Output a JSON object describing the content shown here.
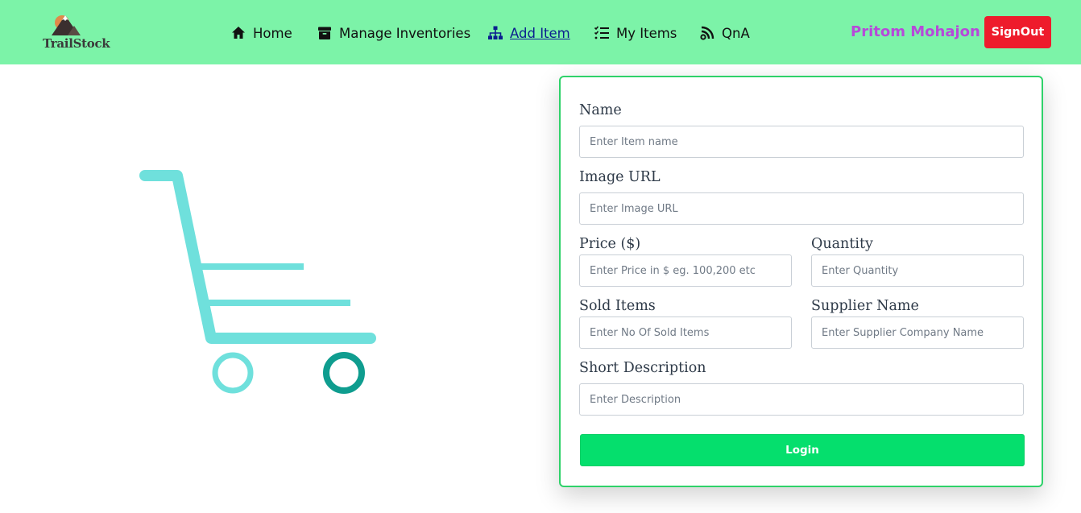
{
  "brand": {
    "name": "TrailStock",
    "logo_icon": "mountain-sun-logo"
  },
  "nav": {
    "items": [
      {
        "label": "Home",
        "icon": "home-icon"
      },
      {
        "label": "Manage Inventories",
        "icon": "archive-box-icon"
      },
      {
        "label": "Add Item",
        "icon": "sitemap-icon",
        "active": true
      },
      {
        "label": "My Items",
        "icon": "checklist-icon"
      },
      {
        "label": "QnA",
        "icon": "blog-icon"
      }
    ],
    "user_name": "Pritom Mohajon",
    "signout_label": "SignOut"
  },
  "illustration": {
    "icon": "shopping-cart-icon"
  },
  "form": {
    "name": {
      "label": "Name",
      "placeholder": "Enter Item name"
    },
    "image_url": {
      "label": "Image URL",
      "placeholder": "Enter Image URL"
    },
    "price": {
      "label": "Price ($)",
      "placeholder": "Enter Price in $ eg. 100,200 etc"
    },
    "quantity": {
      "label": "Quantity",
      "placeholder": "Enter Quantity"
    },
    "sold": {
      "label": "Sold Items",
      "placeholder": "Enter No Of Sold Items"
    },
    "supplier": {
      "label": "Supplier Name",
      "placeholder": "Enter Supplier Company Name"
    },
    "description": {
      "label": "Short Description",
      "placeholder": "Enter Description"
    },
    "submit_label": "Login"
  },
  "colors": {
    "navbar_bg": "#7cf3a8",
    "accent_green": "#05df6d",
    "card_border": "#2fd26a",
    "signout_red": "#ee1b2c",
    "user_name": "#b64ad9",
    "cart_light": "#6fe0dc",
    "cart_dark": "#0f9d8f",
    "active_link": "#0b1f8f"
  }
}
